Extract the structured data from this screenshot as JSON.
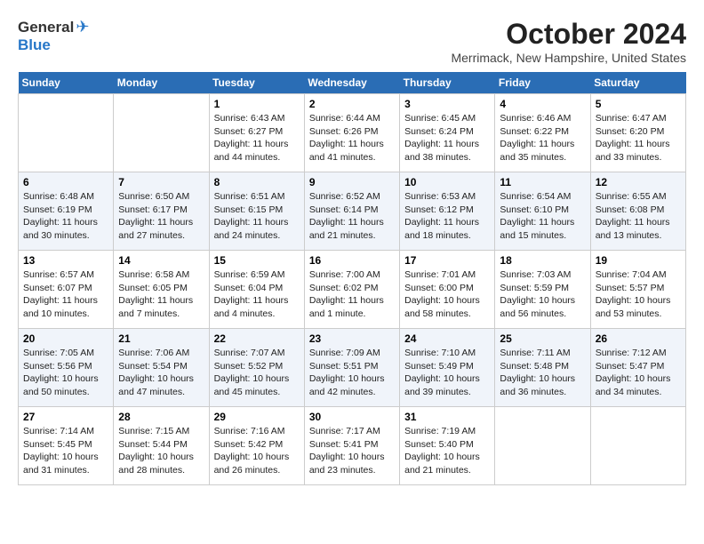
{
  "logo": {
    "general": "General",
    "blue": "Blue",
    "bird": "🐦"
  },
  "title": "October 2024",
  "location": "Merrimack, New Hampshire, United States",
  "weekdays": [
    "Sunday",
    "Monday",
    "Tuesday",
    "Wednesday",
    "Thursday",
    "Friday",
    "Saturday"
  ],
  "weeks": [
    [
      {
        "day": "",
        "sunrise": "",
        "sunset": "",
        "daylight": ""
      },
      {
        "day": "",
        "sunrise": "",
        "sunset": "",
        "daylight": ""
      },
      {
        "day": "1",
        "sunrise": "Sunrise: 6:43 AM",
        "sunset": "Sunset: 6:27 PM",
        "daylight": "Daylight: 11 hours and 44 minutes."
      },
      {
        "day": "2",
        "sunrise": "Sunrise: 6:44 AM",
        "sunset": "Sunset: 6:26 PM",
        "daylight": "Daylight: 11 hours and 41 minutes."
      },
      {
        "day": "3",
        "sunrise": "Sunrise: 6:45 AM",
        "sunset": "Sunset: 6:24 PM",
        "daylight": "Daylight: 11 hours and 38 minutes."
      },
      {
        "day": "4",
        "sunrise": "Sunrise: 6:46 AM",
        "sunset": "Sunset: 6:22 PM",
        "daylight": "Daylight: 11 hours and 35 minutes."
      },
      {
        "day": "5",
        "sunrise": "Sunrise: 6:47 AM",
        "sunset": "Sunset: 6:20 PM",
        "daylight": "Daylight: 11 hours and 33 minutes."
      }
    ],
    [
      {
        "day": "6",
        "sunrise": "Sunrise: 6:48 AM",
        "sunset": "Sunset: 6:19 PM",
        "daylight": "Daylight: 11 hours and 30 minutes."
      },
      {
        "day": "7",
        "sunrise": "Sunrise: 6:50 AM",
        "sunset": "Sunset: 6:17 PM",
        "daylight": "Daylight: 11 hours and 27 minutes."
      },
      {
        "day": "8",
        "sunrise": "Sunrise: 6:51 AM",
        "sunset": "Sunset: 6:15 PM",
        "daylight": "Daylight: 11 hours and 24 minutes."
      },
      {
        "day": "9",
        "sunrise": "Sunrise: 6:52 AM",
        "sunset": "Sunset: 6:14 PM",
        "daylight": "Daylight: 11 hours and 21 minutes."
      },
      {
        "day": "10",
        "sunrise": "Sunrise: 6:53 AM",
        "sunset": "Sunset: 6:12 PM",
        "daylight": "Daylight: 11 hours and 18 minutes."
      },
      {
        "day": "11",
        "sunrise": "Sunrise: 6:54 AM",
        "sunset": "Sunset: 6:10 PM",
        "daylight": "Daylight: 11 hours and 15 minutes."
      },
      {
        "day": "12",
        "sunrise": "Sunrise: 6:55 AM",
        "sunset": "Sunset: 6:08 PM",
        "daylight": "Daylight: 11 hours and 13 minutes."
      }
    ],
    [
      {
        "day": "13",
        "sunrise": "Sunrise: 6:57 AM",
        "sunset": "Sunset: 6:07 PM",
        "daylight": "Daylight: 11 hours and 10 minutes."
      },
      {
        "day": "14",
        "sunrise": "Sunrise: 6:58 AM",
        "sunset": "Sunset: 6:05 PM",
        "daylight": "Daylight: 11 hours and 7 minutes."
      },
      {
        "day": "15",
        "sunrise": "Sunrise: 6:59 AM",
        "sunset": "Sunset: 6:04 PM",
        "daylight": "Daylight: 11 hours and 4 minutes."
      },
      {
        "day": "16",
        "sunrise": "Sunrise: 7:00 AM",
        "sunset": "Sunset: 6:02 PM",
        "daylight": "Daylight: 11 hours and 1 minute."
      },
      {
        "day": "17",
        "sunrise": "Sunrise: 7:01 AM",
        "sunset": "Sunset: 6:00 PM",
        "daylight": "Daylight: 10 hours and 58 minutes."
      },
      {
        "day": "18",
        "sunrise": "Sunrise: 7:03 AM",
        "sunset": "Sunset: 5:59 PM",
        "daylight": "Daylight: 10 hours and 56 minutes."
      },
      {
        "day": "19",
        "sunrise": "Sunrise: 7:04 AM",
        "sunset": "Sunset: 5:57 PM",
        "daylight": "Daylight: 10 hours and 53 minutes."
      }
    ],
    [
      {
        "day": "20",
        "sunrise": "Sunrise: 7:05 AM",
        "sunset": "Sunset: 5:56 PM",
        "daylight": "Daylight: 10 hours and 50 minutes."
      },
      {
        "day": "21",
        "sunrise": "Sunrise: 7:06 AM",
        "sunset": "Sunset: 5:54 PM",
        "daylight": "Daylight: 10 hours and 47 minutes."
      },
      {
        "day": "22",
        "sunrise": "Sunrise: 7:07 AM",
        "sunset": "Sunset: 5:52 PM",
        "daylight": "Daylight: 10 hours and 45 minutes."
      },
      {
        "day": "23",
        "sunrise": "Sunrise: 7:09 AM",
        "sunset": "Sunset: 5:51 PM",
        "daylight": "Daylight: 10 hours and 42 minutes."
      },
      {
        "day": "24",
        "sunrise": "Sunrise: 7:10 AM",
        "sunset": "Sunset: 5:49 PM",
        "daylight": "Daylight: 10 hours and 39 minutes."
      },
      {
        "day": "25",
        "sunrise": "Sunrise: 7:11 AM",
        "sunset": "Sunset: 5:48 PM",
        "daylight": "Daylight: 10 hours and 36 minutes."
      },
      {
        "day": "26",
        "sunrise": "Sunrise: 7:12 AM",
        "sunset": "Sunset: 5:47 PM",
        "daylight": "Daylight: 10 hours and 34 minutes."
      }
    ],
    [
      {
        "day": "27",
        "sunrise": "Sunrise: 7:14 AM",
        "sunset": "Sunset: 5:45 PM",
        "daylight": "Daylight: 10 hours and 31 minutes."
      },
      {
        "day": "28",
        "sunrise": "Sunrise: 7:15 AM",
        "sunset": "Sunset: 5:44 PM",
        "daylight": "Daylight: 10 hours and 28 minutes."
      },
      {
        "day": "29",
        "sunrise": "Sunrise: 7:16 AM",
        "sunset": "Sunset: 5:42 PM",
        "daylight": "Daylight: 10 hours and 26 minutes."
      },
      {
        "day": "30",
        "sunrise": "Sunrise: 7:17 AM",
        "sunset": "Sunset: 5:41 PM",
        "daylight": "Daylight: 10 hours and 23 minutes."
      },
      {
        "day": "31",
        "sunrise": "Sunrise: 7:19 AM",
        "sunset": "Sunset: 5:40 PM",
        "daylight": "Daylight: 10 hours and 21 minutes."
      },
      {
        "day": "",
        "sunrise": "",
        "sunset": "",
        "daylight": ""
      },
      {
        "day": "",
        "sunrise": "",
        "sunset": "",
        "daylight": ""
      }
    ]
  ]
}
